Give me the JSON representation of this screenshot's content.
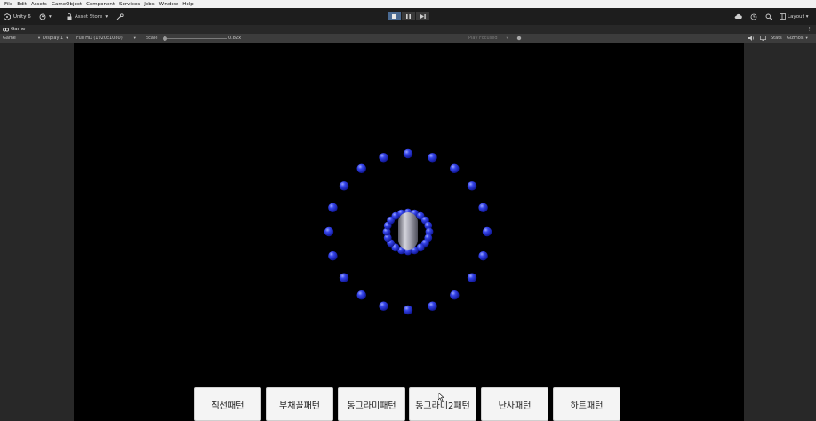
{
  "menubar": {
    "items": [
      "File",
      "Edit",
      "Assets",
      "GameObject",
      "Component",
      "Services",
      "Jobs",
      "Window",
      "Help"
    ]
  },
  "toolbar": {
    "account_label": "Unity 6",
    "asset_store_label": "Asset Store",
    "layout_label": "Layout"
  },
  "game_tab": {
    "label": "Game"
  },
  "controls": {
    "view_mode": "Game",
    "display": "Display 1",
    "resolution": "Full HD (1920x1080)",
    "scale_label": "Scale",
    "scale_value": "0.82x",
    "scale_fraction": 0.03,
    "play_focused": "Play Focused",
    "stats": "Stats",
    "gizmos": "Gizmos"
  },
  "scene": {
    "sphere_color": "#2e3ae0",
    "player_color": "#a8a8b4",
    "background": "#000000"
  },
  "buttons": [
    "직선패턴",
    "부채꼴패턴",
    "동그라미패턴",
    "동그라미2패턴",
    "난사패턴",
    "하트패턴"
  ]
}
